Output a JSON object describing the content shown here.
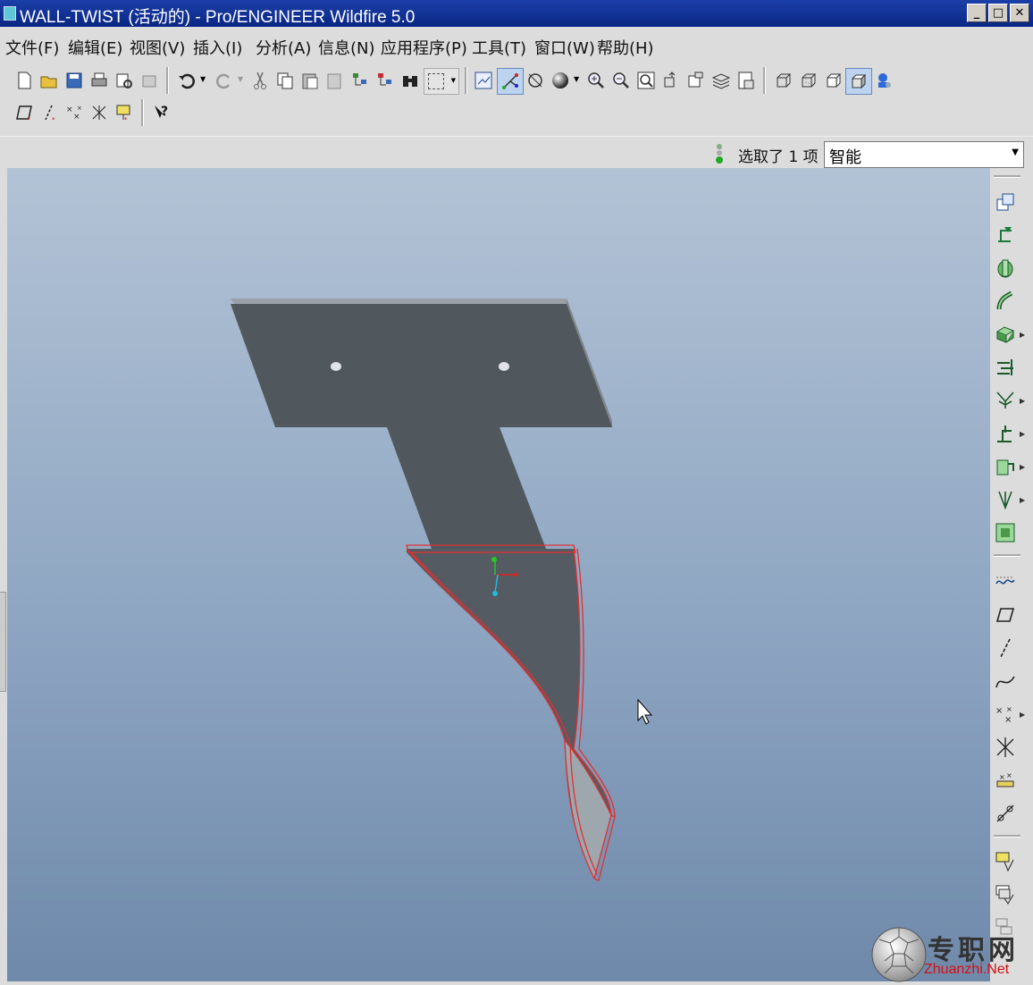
{
  "window": {
    "title": "WALL-TWIST (活动的) - Pro/ENGINEER Wildfire 5.0",
    "buttons": [
      "minimize-icon",
      "maximize-icon",
      "close-icon"
    ]
  },
  "menu": [
    {
      "label": "文件(F)"
    },
    {
      "label": "编辑(E)"
    },
    {
      "label": "视图(V)"
    },
    {
      "label": "插入(I)"
    },
    {
      "label": "分析(A)"
    },
    {
      "label": "信息(N)"
    },
    {
      "label": "应用程序(P)"
    },
    {
      "label": "工具(T)"
    },
    {
      "label": "窗口(W)"
    },
    {
      "label": "帮助(H)"
    }
  ],
  "toolbar": {
    "row1_icons": [
      "new-icon",
      "open-icon",
      "save-icon",
      "print-icon",
      "print-preview-icon",
      "send-icon",
      "undo-icon",
      "redo-icon",
      "cut-icon",
      "copy-icon",
      "paste-icon",
      "paste-special-icon",
      "regenerate-icon",
      "regenerate-manager-icon",
      "find-icon",
      "selection-box-icon",
      "datum-display-icon",
      "spin-center-icon",
      "saved-views-icon",
      "appearance-icon",
      "zoom-in-icon",
      "zoom-out-icon",
      "refit-icon",
      "reorient-icon",
      "view-manager-icon",
      "layers-icon",
      "model-tree-icon",
      "wireframe-icon",
      "hidden-line-icon",
      "no-hidden-icon",
      "shading-icon",
      "enhanced-realism-icon"
    ],
    "row2_icons": [
      "datum-plane-display-icon",
      "datum-axis-display-icon",
      "point-display-icon",
      "csys-display-icon",
      "annotation-display-icon",
      "context-help-icon"
    ]
  },
  "status": {
    "selection_text": "选取了 1 项",
    "filter_value": "智能"
  },
  "right_toolbar": {
    "icons": [
      "sketch-tool-icon",
      "extrude-icon",
      "revolve-icon",
      "variable-sweep-icon",
      "blend-icon",
      "hole-icon",
      "round-icon",
      "shell-icon",
      "rib-icon",
      "draft-icon",
      "pattern-icon",
      "curve-icon",
      "datum-plane-icon",
      "datum-axis-icon",
      "datum-curve-icon",
      "datum-point-icon",
      "csys-icon",
      "analysis-icon",
      "sketch-icon",
      "copy-feature-icon",
      "group-icon",
      "mirror-icon"
    ]
  },
  "watermark": {
    "cn": "专职网",
    "en": "Zhuanzhi.Net"
  }
}
